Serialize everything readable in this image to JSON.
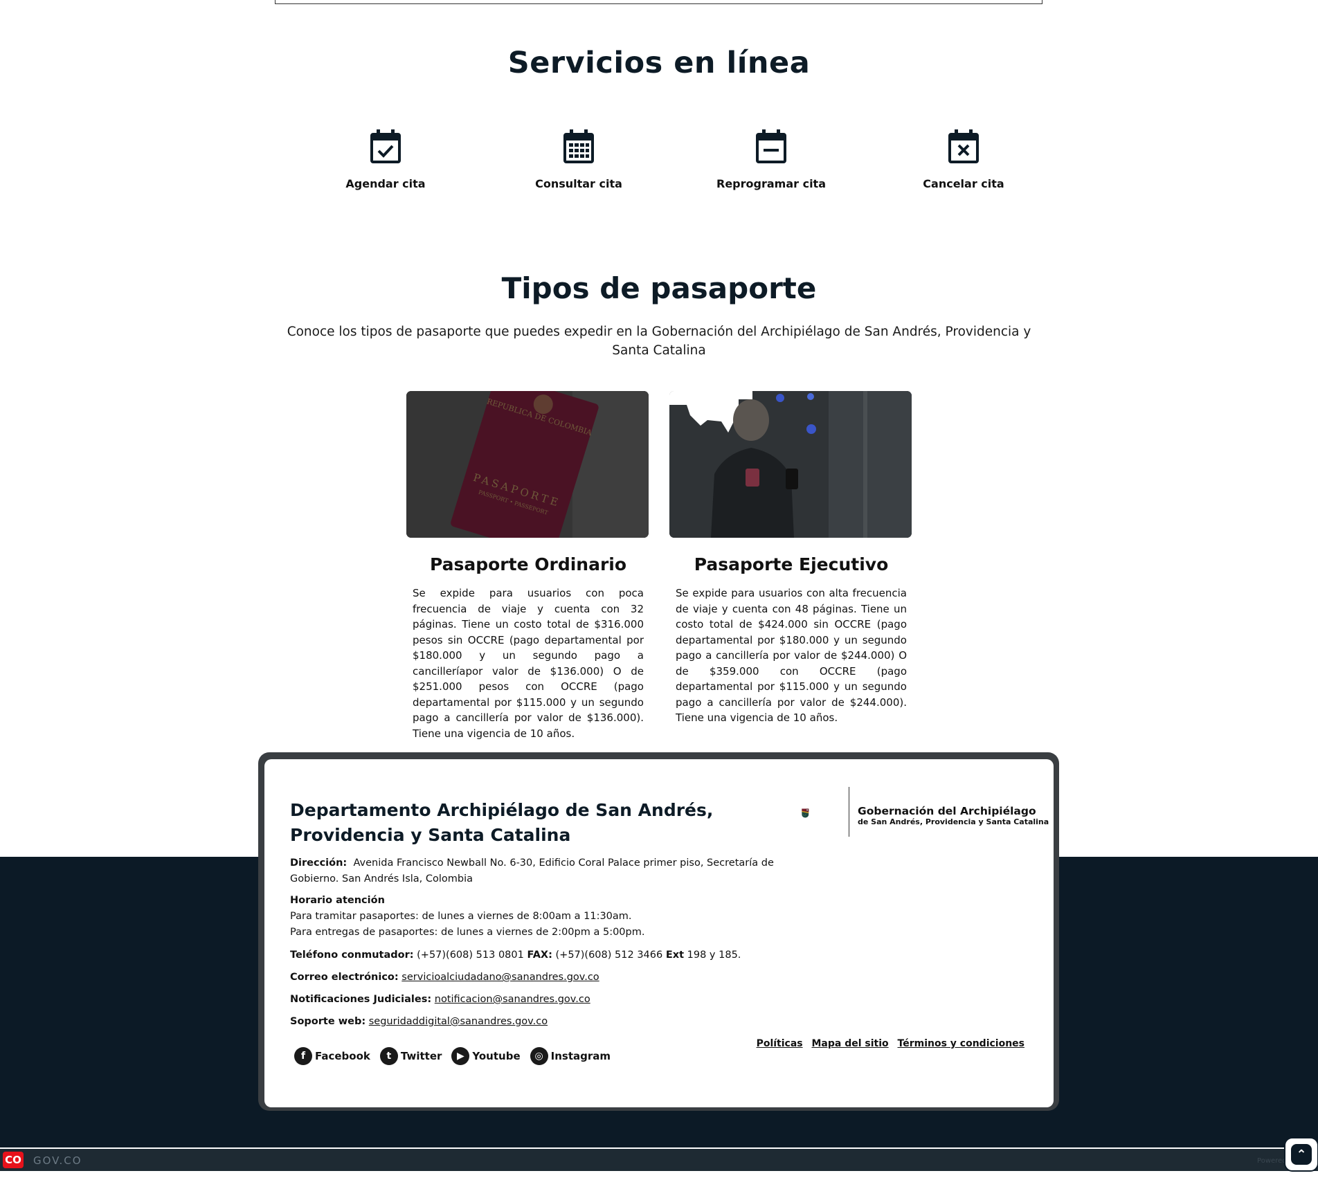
{
  "services": {
    "title": "Servicios en línea",
    "items": [
      {
        "label": "Agendar cita",
        "icon": "calendar-check-icon"
      },
      {
        "label": "Consultar cita",
        "icon": "calendar-grid-icon"
      },
      {
        "label": "Reprogramar cita",
        "icon": "calendar-minus-icon"
      },
      {
        "label": "Cancelar cita",
        "icon": "calendar-x-icon"
      }
    ]
  },
  "passports": {
    "title": "Tipos de pasaporte",
    "subtitle": "Conoce los tipos de pasaporte que puedes expedir en la Gobernación del Archipiélago de San Andrés, Providencia y Santa Catalina",
    "cards": [
      {
        "title": "Pasaporte Ordinario",
        "text": "Se expide para usuarios con poca frecuencia de viaje y cuenta con 32 páginas. Tiene un costo total de $316.000 pesos sin OCCRE (pago departamental por $180.000 y un segundo pago a cancilleríapor valor de $136.000) O de $251.000 pesos con OCCRE (pago departamental por $115.000 y un segundo pago a cancillería por valor de $136.000). Tiene una vigencia de 10 años.",
        "image_text": "REPUBLICA DE COLOMBIA",
        "image_text2": "PASAPORTE",
        "image_text3": "PASSPORT • PASSEPORT"
      },
      {
        "title": "Pasaporte Ejecutivo",
        "text": "Se expide para usuarios con alta frecuencia de viaje y cuenta con 48 páginas. Tiene un costo total de $424.000 sin OCCRE (pago departamental por $180.000 y un segundo pago a cancillería por valor de $244.000) O de $359.000 con OCCRE (pago departamental por $115.000 y un segundo pago a cancillería por valor de $244.000). Tiene una vigencia de 10 años."
      }
    ]
  },
  "footer": {
    "title": "Departamento Archipiélago de San Andrés, Providencia y Santa Catalina",
    "address_label": "Dirección:",
    "address": "Avenida Francisco Newball No. 6-30, Edificio Coral Palace primer piso, Secretaría de Gobierno. San Andrés Isla, Colombia",
    "hours_label": "Horario atención",
    "hours_1": "Para tramitar pasaportes: de lunes a viernes de 8:00am a 11:30am.",
    "hours_2": "Para entregas de pasaportes: de lunes a viernes de 2:00pm a 5:00pm.",
    "phone_label": "Teléfono conmutador:",
    "phone": "(+57)(608) 513 0801",
    "fax_label": "FAX:",
    "fax": "(+57)(608) 512 3466",
    "ext_label": "Ext",
    "ext": "198 y 185.",
    "email_label": "Correo electrónico:",
    "email": "servicioalciudadano@sanandres.gov.co",
    "legal_label": "Notificaciones Judiciales:",
    "legal_email": "notificacion@sanandres.gov.co",
    "support_label": "Soporte web:",
    "support_email": "seguridaddigital@sanandres.gov.co",
    "logo_line1": "Gobernación del Archipiélago",
    "logo_line2": "de San Andrés, Providencia y Santa Catalina",
    "links": [
      "Políticas",
      "Mapa del sitio",
      "Términos y condiciones"
    ],
    "social": [
      {
        "label": "Facebook",
        "icon": "facebook-icon",
        "glyph": "f"
      },
      {
        "label": "Twitter",
        "icon": "twitter-icon",
        "glyph": "t"
      },
      {
        "label": "Youtube",
        "icon": "youtube-icon",
        "glyph": "▶"
      },
      {
        "label": "Instagram",
        "icon": "instagram-icon",
        "glyph": "◎"
      }
    ]
  },
  "govbar": {
    "badge": "CO",
    "text": "GOV.CO",
    "powered": "Powered by"
  },
  "colors": {
    "dark": "#0c1a26",
    "accent_red": "#e7121b",
    "text": "#111111"
  }
}
